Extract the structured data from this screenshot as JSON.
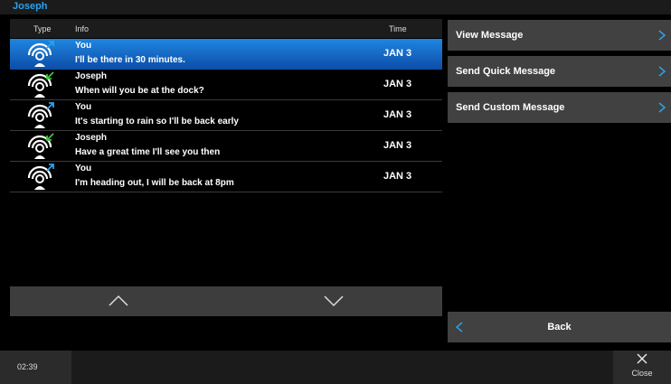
{
  "header": {
    "title": "Joseph"
  },
  "list": {
    "columns": {
      "type": "Type",
      "info": "Info",
      "time": "Time"
    },
    "rows": [
      {
        "sender": "You",
        "message": "I'll be there in 30 minutes.",
        "time": "JAN 3",
        "direction": "outgoing",
        "selected": true
      },
      {
        "sender": "Joseph",
        "message": "When will you be at the dock?",
        "time": "JAN 3",
        "direction": "incoming",
        "selected": false
      },
      {
        "sender": "You",
        "message": "It's starting to rain so I'll be back early",
        "time": "JAN 3",
        "direction": "outgoing",
        "selected": false
      },
      {
        "sender": "Joseph",
        "message": "Have a great time I'll see you then",
        "time": "JAN 3",
        "direction": "incoming",
        "selected": false
      },
      {
        "sender": "You",
        "message": "I'm heading out, I will be back at 8pm",
        "time": "JAN 3",
        "direction": "outgoing",
        "selected": false
      }
    ]
  },
  "actions": {
    "view": "View Message",
    "quick": "Send Quick Message",
    "custom": "Send Custom Message",
    "back": "Back"
  },
  "footer": {
    "clock": "02:39",
    "close": "Close"
  },
  "colors": {
    "accent": "#2aa3ee",
    "outgoing_arrow": "#2aa3ee",
    "incoming_arrow": "#3fc43f",
    "selected_row": "#1f86e0",
    "button_bg": "#414141"
  }
}
